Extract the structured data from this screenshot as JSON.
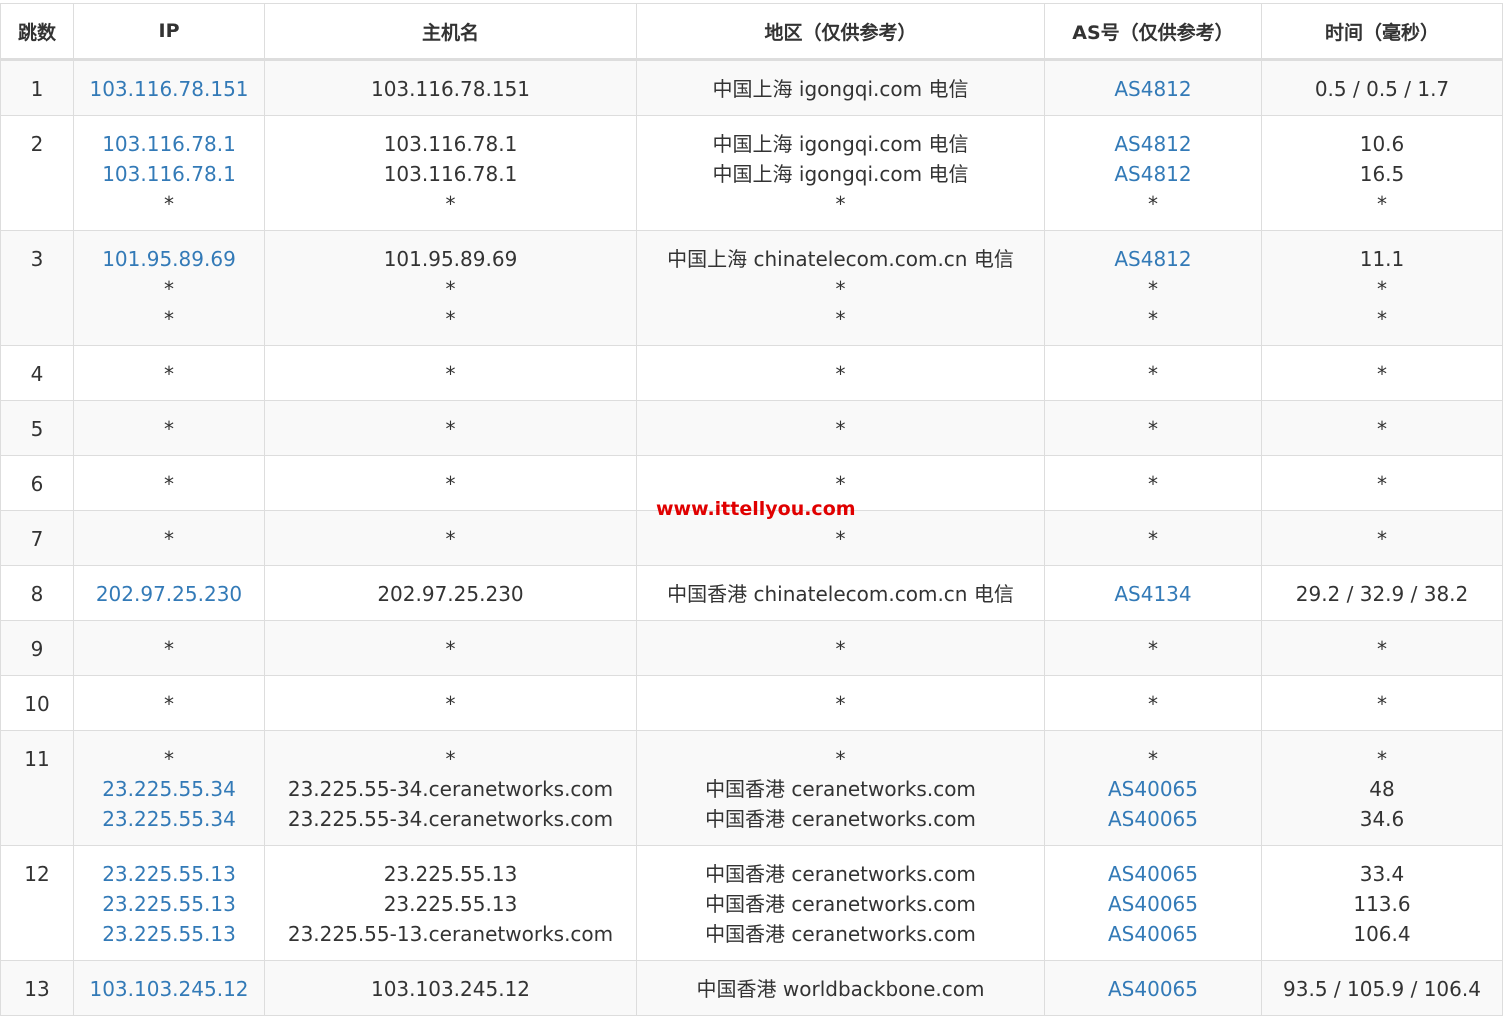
{
  "table": {
    "headers": [
      "跳数",
      "IP",
      "主机名",
      "地区（仅供参考）",
      "AS号（仅供参考）",
      "时间（毫秒）"
    ],
    "rows": [
      {
        "hop": "1",
        "ip": [
          "103.116.78.151"
        ],
        "host": [
          "103.116.78.151"
        ],
        "region": [
          "中国上海 igongqi.com 电信"
        ],
        "as": [
          "AS4812"
        ],
        "time": [
          "0.5 / 0.5 / 1.7"
        ]
      },
      {
        "hop": "2",
        "ip": [
          "103.116.78.1",
          "103.116.78.1",
          "*"
        ],
        "host": [
          "103.116.78.1",
          "103.116.78.1",
          "*"
        ],
        "region": [
          "中国上海 igongqi.com 电信",
          "中国上海 igongqi.com 电信",
          "*"
        ],
        "as": [
          "AS4812",
          "AS4812",
          "*"
        ],
        "time": [
          "10.6",
          "16.5",
          "*"
        ]
      },
      {
        "hop": "3",
        "ip": [
          "101.95.89.69",
          "*",
          "*"
        ],
        "host": [
          "101.95.89.69",
          "*",
          "*"
        ],
        "region": [
          "中国上海 chinatelecom.com.cn 电信",
          "*",
          "*"
        ],
        "as": [
          "AS4812",
          "*",
          "*"
        ],
        "time": [
          "11.1",
          "*",
          "*"
        ]
      },
      {
        "hop": "4",
        "ip": [
          "*"
        ],
        "host": [
          "*"
        ],
        "region": [
          "*"
        ],
        "as": [
          "*"
        ],
        "time": [
          "*"
        ]
      },
      {
        "hop": "5",
        "ip": [
          "*"
        ],
        "host": [
          "*"
        ],
        "region": [
          "*"
        ],
        "as": [
          "*"
        ],
        "time": [
          "*"
        ]
      },
      {
        "hop": "6",
        "ip": [
          "*"
        ],
        "host": [
          "*"
        ],
        "region": [
          "*"
        ],
        "as": [
          "*"
        ],
        "time": [
          "*"
        ]
      },
      {
        "hop": "7",
        "ip": [
          "*"
        ],
        "host": [
          "*"
        ],
        "region": [
          "*"
        ],
        "as": [
          "*"
        ],
        "time": [
          "*"
        ]
      },
      {
        "hop": "8",
        "ip": [
          "202.97.25.230"
        ],
        "host": [
          "202.97.25.230"
        ],
        "region": [
          "中国香港 chinatelecom.com.cn 电信"
        ],
        "as": [
          "AS4134"
        ],
        "time": [
          "29.2 / 32.9 / 38.2"
        ]
      },
      {
        "hop": "9",
        "ip": [
          "*"
        ],
        "host": [
          "*"
        ],
        "region": [
          "*"
        ],
        "as": [
          "*"
        ],
        "time": [
          "*"
        ]
      },
      {
        "hop": "10",
        "ip": [
          "*"
        ],
        "host": [
          "*"
        ],
        "region": [
          "*"
        ],
        "as": [
          "*"
        ],
        "time": [
          "*"
        ]
      },
      {
        "hop": "11",
        "ip": [
          "*",
          "23.225.55.34",
          "23.225.55.34"
        ],
        "host": [
          "*",
          "23.225.55-34.ceranetworks.com",
          "23.225.55-34.ceranetworks.com"
        ],
        "region": [
          "*",
          "中国香港 ceranetworks.com",
          "中国香港 ceranetworks.com"
        ],
        "as": [
          "*",
          "AS40065",
          "AS40065"
        ],
        "time": [
          "*",
          "48",
          "34.6"
        ]
      },
      {
        "hop": "12",
        "ip": [
          "23.225.55.13",
          "23.225.55.13",
          "23.225.55.13"
        ],
        "host": [
          "23.225.55.13",
          "23.225.55.13",
          "23.225.55-13.ceranetworks.com"
        ],
        "region": [
          "中国香港 ceranetworks.com",
          "中国香港 ceranetworks.com",
          "中国香港 ceranetworks.com"
        ],
        "as": [
          "AS40065",
          "AS40065",
          "AS40065"
        ],
        "time": [
          "33.4",
          "113.6",
          "106.4"
        ]
      },
      {
        "hop": "13",
        "ip": [
          "103.103.245.12"
        ],
        "host": [
          "103.103.245.12"
        ],
        "region": [
          "中国香港 worldbackbone.com"
        ],
        "as": [
          "AS40065"
        ],
        "time": [
          "93.5 / 105.9 / 106.4"
        ]
      }
    ]
  },
  "watermark": "www.ittellyou.com",
  "colors": {
    "link": "#337ab7",
    "watermark": "#e00000",
    "border": "#dddddd",
    "stripe": "#f9f9f9"
  }
}
